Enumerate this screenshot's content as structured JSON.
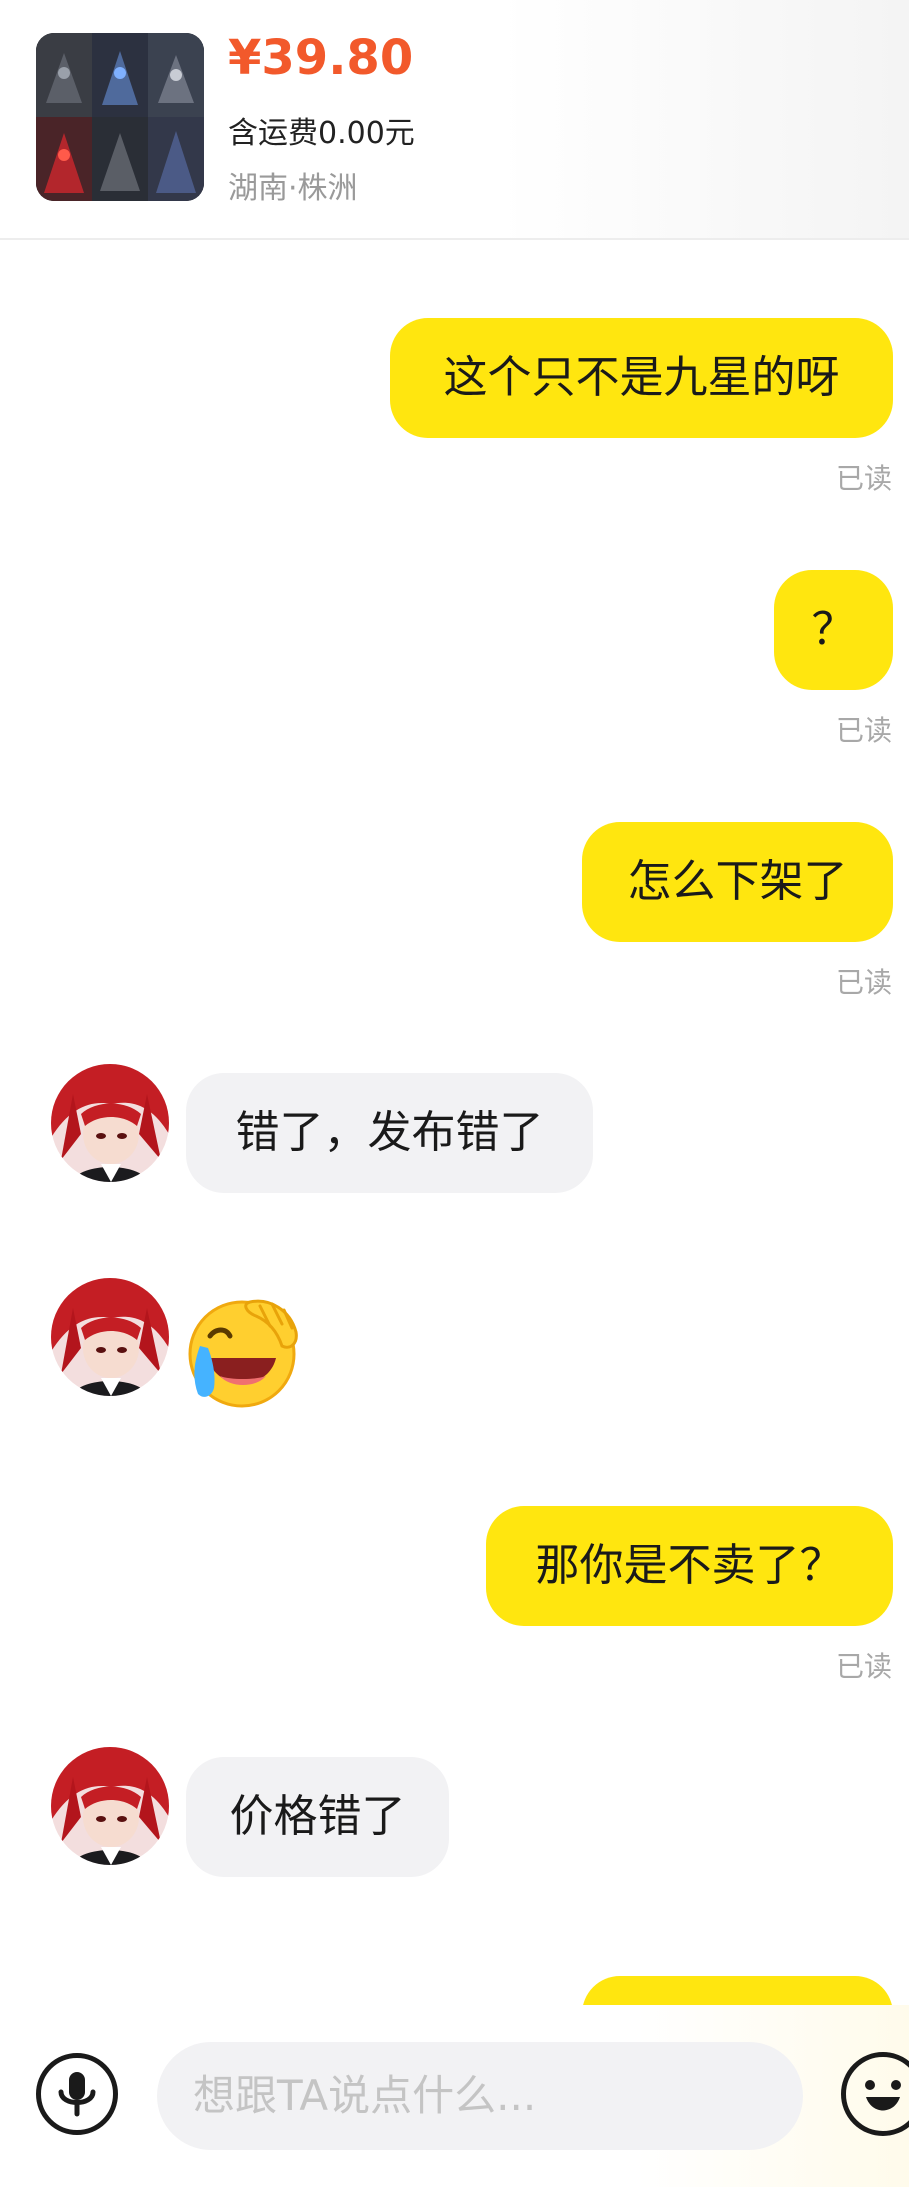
{
  "product": {
    "image": "product-thumbnail",
    "price": "¥39.80",
    "shipping": "含运费0.00元",
    "location": "湖南·株洲"
  },
  "messages": [
    {
      "sender": "me",
      "text": "这个只不是九星的呀",
      "status": "已读"
    },
    {
      "sender": "me",
      "text": "？",
      "status": "已读"
    },
    {
      "sender": "me",
      "text": "怎么下架了",
      "status": "已读"
    },
    {
      "sender": "them",
      "text": "错了，发布错了"
    },
    {
      "sender": "them",
      "type": "emoji",
      "emoji": "crying-laughing-facepalm-emoji"
    },
    {
      "sender": "me",
      "text": "那你是不卖了？",
      "status": "已读"
    },
    {
      "sender": "them",
      "text": "价格错了"
    },
    {
      "sender": "me",
      "text": "",
      "partial": true
    }
  ],
  "input": {
    "placeholder": "想跟TA说点什么...",
    "voice_icon": "microphone-icon",
    "emoji_icon": "smiley-icon"
  },
  "colors": {
    "accent": "#ffe60f",
    "price": "#f2592b",
    "incoming_bubble": "#f2f2f4",
    "status_text": "#a8a8a8"
  }
}
